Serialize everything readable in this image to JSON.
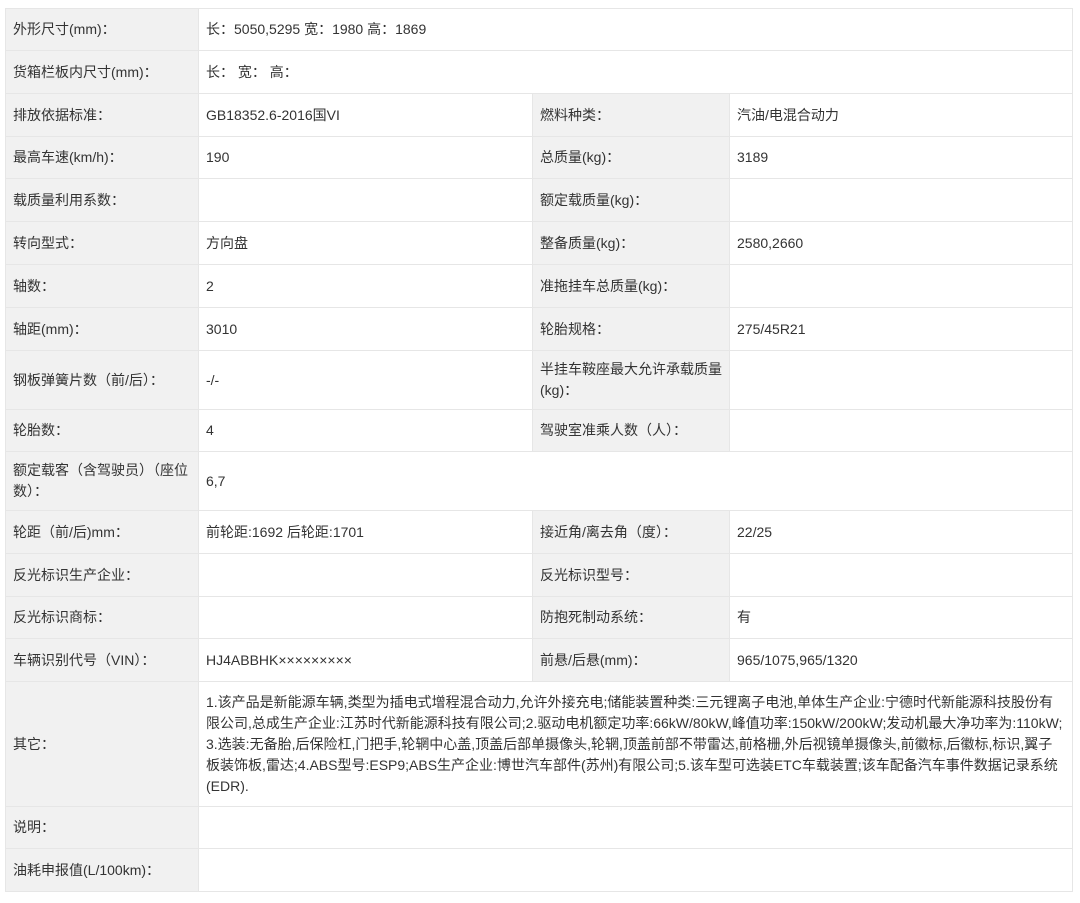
{
  "rows": [
    {
      "label": "外形尺寸(mm)：",
      "value": "长：5050,5295 宽：1980 高：1869"
    },
    {
      "label": "货箱栏板内尺寸(mm)：",
      "value": "长： 宽： 高："
    },
    {
      "label": "排放依据标准：",
      "value": "GB18352.6-2016国VI",
      "label2": "燃料种类：",
      "value2": "汽油/电混合动力"
    },
    {
      "label": "最高车速(km/h)：",
      "value": "190",
      "label2": "总质量(kg)：",
      "value2": "3189"
    },
    {
      "label": "载质量利用系数：",
      "value": "",
      "label2": "额定载质量(kg)：",
      "value2": ""
    },
    {
      "label": "转向型式：",
      "value": "方向盘",
      "label2": "整备质量(kg)：",
      "value2": "2580,2660"
    },
    {
      "label": "轴数：",
      "value": "2",
      "label2": "准拖挂车总质量(kg)：",
      "value2": ""
    },
    {
      "label": "轴距(mm)：",
      "value": "3010",
      "label2": "轮胎规格：",
      "value2": "275/45R21"
    },
    {
      "label": "钢板弹簧片数（前/后）：",
      "value": "-/-",
      "label2": "半挂车鞍座最大允许承载质量(kg)：",
      "value2": ""
    },
    {
      "label": "轮胎数：",
      "value": "4",
      "label2": "驾驶室准乘人数（人）：",
      "value2": ""
    },
    {
      "label": "额定载客（含驾驶员）（座位数）：",
      "value": "6,7"
    },
    {
      "label": "轮距（前/后)mm：",
      "value": "前轮距:1692 后轮距:1701",
      "label2": "接近角/离去角（度）：",
      "value2": "22/25"
    },
    {
      "label": "反光标识生产企业：",
      "value": "",
      "label2": "反光标识型号：",
      "value2": ""
    },
    {
      "label": "反光标识商标：",
      "value": "",
      "label2": "防抱死制动系统：",
      "value2": "有"
    },
    {
      "label": "车辆识别代号（VIN）：",
      "value": "HJ4ABBHK×××××××××",
      "label2": "前悬/后悬(mm)：",
      "value2": "965/1075,965/1320"
    },
    {
      "label": "其它：",
      "value": "1.该产品是新能源车辆,类型为插电式增程混合动力,允许外接充电;储能装置种类:三元锂离子电池,单体生产企业:宁德时代新能源科技股份有限公司,总成生产企业:江苏时代新能源科技有限公司;2.驱动电机额定功率:66kW/80kW,峰值功率:150kW/200kW;发动机最大净功率为:110kW;3.选装:无备胎,后保险杠,门把手,轮辋中心盖,顶盖后部单摄像头,轮辋,顶盖前部不带雷达,前格栅,外后视镜单摄像头,前徽标,后徽标,标识,翼子板装饰板,雷达;4.ABS型号:ESP9;ABS生产企业:博世汽车部件(苏州)有限公司;5.该车型可选装ETC车载装置;该车配备汽车事件数据记录系统(EDR)."
    },
    {
      "label": "说明：",
      "value": ""
    },
    {
      "label": "油耗申报值(L/100km)：",
      "value": ""
    }
  ]
}
